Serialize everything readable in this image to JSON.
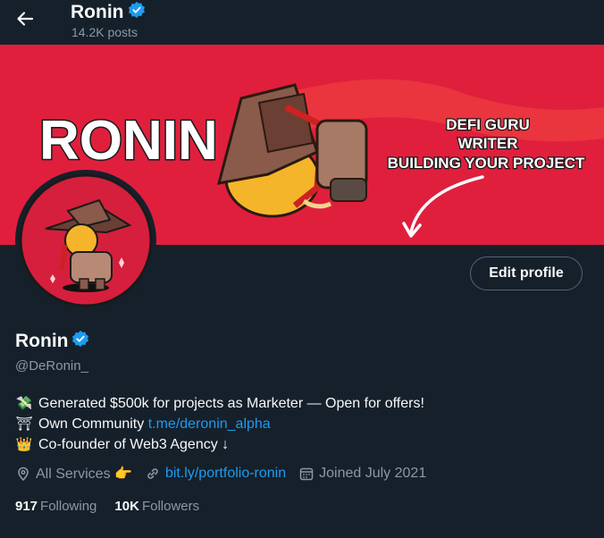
{
  "header": {
    "name": "Ronin",
    "posts": "14.2K posts"
  },
  "banner": {
    "title": "RONIN",
    "lines": [
      "DEFI GURU",
      "WRITER",
      "BUILDING YOUR PROJECT"
    ],
    "colors": {
      "background": "#e01f3d",
      "text": "#ffffff"
    }
  },
  "profile": {
    "edit_label": "Edit profile",
    "name": "Ronin",
    "handle": "@DeRonin_",
    "bio": [
      {
        "emoji": "💸",
        "text": "Generated $500k for projects as Marketer — Open for offers!"
      },
      {
        "emoji": "⛩",
        "text": "Own Community ",
        "link": "t.me/deronin_alpha"
      },
      {
        "emoji": "👑",
        "text": "Co-founder of Web3 Agency ↓"
      }
    ],
    "category": "All Services 👉",
    "website": "bit.ly/portfolio-ronin",
    "joined": "Joined July 2021",
    "following_count": "917",
    "following_label": "Following",
    "followers_count": "10K",
    "followers_label": "Followers"
  },
  "colors": {
    "accent": "#1d9bf0",
    "verified": "#1d9bf0",
    "background": "#15202b"
  }
}
